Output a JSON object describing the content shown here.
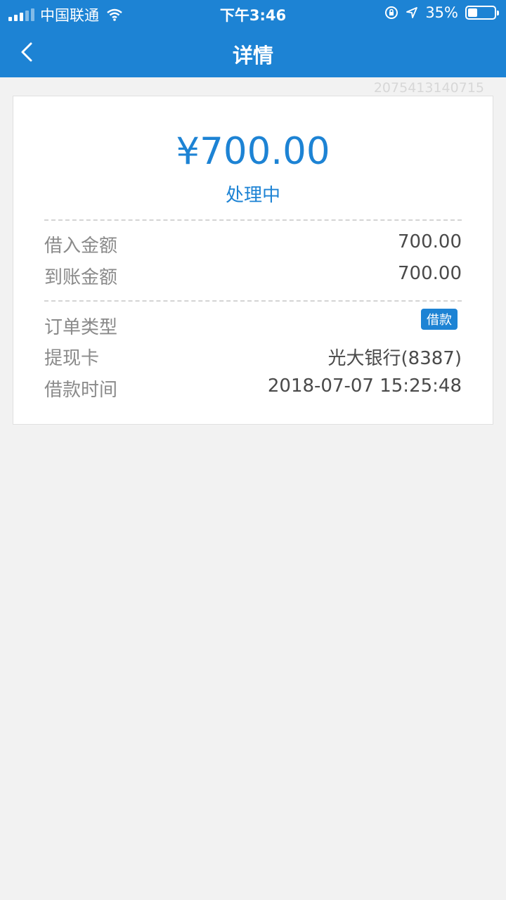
{
  "status_bar": {
    "carrier": "中国联通",
    "time": "下午3:46",
    "battery": "35%",
    "battery_level": 0.35,
    "icons": [
      "signal-icon",
      "wifi-icon",
      "rotation-lock-icon",
      "location-icon",
      "battery-icon"
    ]
  },
  "nav": {
    "title": "详情",
    "back_icon": "chevron-left-icon"
  },
  "order_no": "2075413140715",
  "summary": {
    "amount": "¥700.00",
    "status": "处理中"
  },
  "details": {
    "borrow_amount_label": "借入金额",
    "borrow_amount_value": "700.00",
    "received_amount_label": "到账金额",
    "received_amount_value": "700.00",
    "order_type_label": "订单类型",
    "order_type_tag": "借款",
    "card_label": "提现卡",
    "card_value": "光大银行(8387)",
    "time_label": "借款时间",
    "time_value": "2018-07-07 15:25:48"
  },
  "colors": {
    "primary": "#1d83d4",
    "background": "#f2f2f2"
  }
}
